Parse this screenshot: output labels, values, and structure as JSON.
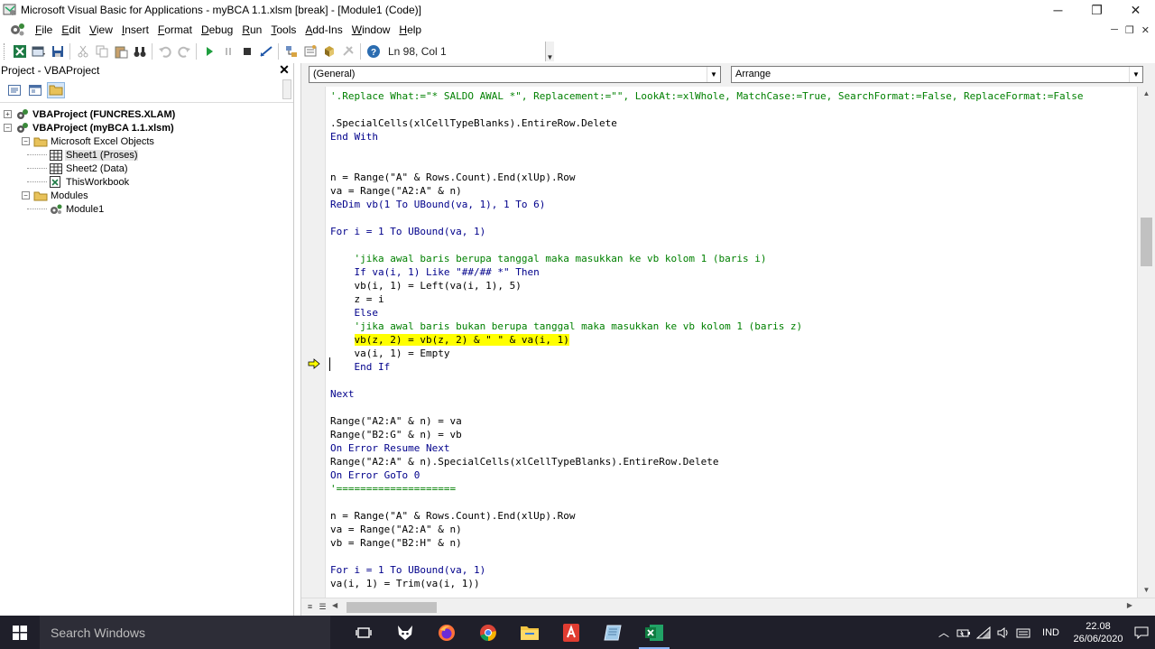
{
  "window": {
    "title": "Microsoft Visual Basic for Applications - myBCA 1.1.xlsm [break] - [Module1 (Code)]",
    "minimize": "─",
    "restore": "❐",
    "close": "✕"
  },
  "menu": {
    "items": [
      {
        "u": "F",
        "rest": "ile"
      },
      {
        "u": "E",
        "rest": "dit"
      },
      {
        "u": "V",
        "rest": "iew"
      },
      {
        "u": "I",
        "rest": "nsert"
      },
      {
        "u": "F",
        "rest": "ormat",
        "pre": ""
      },
      {
        "u": "D",
        "rest": "ebug"
      },
      {
        "u": "R",
        "rest": "un"
      },
      {
        "u": "T",
        "rest": "ools"
      },
      {
        "u": "A",
        "rest": "dd-Ins"
      },
      {
        "u": "W",
        "rest": "indow"
      },
      {
        "u": "H",
        "rest": "elp"
      }
    ],
    "mdi_minimize": "─",
    "mdi_restore": "❐",
    "mdi_close": "✕"
  },
  "toolbar": {
    "cursor_position": "Ln 98, Col 1"
  },
  "project_pane": {
    "title": "Project - VBAProject",
    "close": "✕",
    "tree": [
      {
        "label": "VBAProject (FUNCRES.XLAM)",
        "bold": true,
        "expander": "+",
        "level": 0,
        "icon": "vbaproject-icon"
      },
      {
        "label": "VBAProject (myBCA 1.1.xlsm)",
        "bold": true,
        "expander": "−",
        "level": 0,
        "icon": "vbaproject-icon"
      },
      {
        "label": "Microsoft Excel Objects",
        "bold": false,
        "expander": "−",
        "level": 1,
        "icon": "folder-icon"
      },
      {
        "label": "Sheet1 (Proses)",
        "bold": false,
        "expander": "",
        "level": 2,
        "icon": "worksheet-icon",
        "selected": true
      },
      {
        "label": "Sheet2 (Data)",
        "bold": false,
        "expander": "",
        "level": 2,
        "icon": "worksheet-icon"
      },
      {
        "label": "ThisWorkbook",
        "bold": false,
        "expander": "",
        "level": 2,
        "icon": "workbook-icon"
      },
      {
        "label": "Modules",
        "bold": false,
        "expander": "−",
        "level": 1,
        "icon": "folder-icon"
      },
      {
        "label": "Module1",
        "bold": false,
        "expander": "",
        "level": 2,
        "icon": "module-icon"
      }
    ]
  },
  "code_window": {
    "object_combo": "(General)",
    "procedure_combo": "Arrange",
    "lines": [
      {
        "text": "'.Replace What:=\"* SALDO AWAL *\", Replacement:=\"\", LookAt:=xlWhole, MatchCase:=True, SearchFormat:=False, ReplaceFormat:=False",
        "style": "cm"
      },
      {
        "text": "",
        "style": ""
      },
      {
        "text": ".SpecialCells(xlCellTypeBlanks).EntireRow.Delete",
        "style": ""
      },
      {
        "text": "End With",
        "style": "kw"
      },
      {
        "text": "",
        "style": ""
      },
      {
        "text": "",
        "style": ""
      },
      {
        "text": "n = Range(\"A\" & Rows.Count).End(xlUp).Row",
        "style": ""
      },
      {
        "text": "va = Range(\"A2:A\" & n)",
        "style": ""
      },
      {
        "text": "ReDim vb(1 To UBound(va, 1), 1 To 6)",
        "style": "kw"
      },
      {
        "text": "",
        "style": ""
      },
      {
        "text": "For i = 1 To UBound(va, 1)",
        "style": "kw"
      },
      {
        "text": "",
        "style": ""
      },
      {
        "text": "    'jika awal baris berupa tanggal maka masukkan ke vb kolom 1 (baris i)",
        "style": "cm"
      },
      {
        "text": "    If va(i, 1) Like \"##/## *\" Then",
        "style": "kw"
      },
      {
        "text": "    vb(i, 1) = Left(va(i, 1), 5)",
        "style": ""
      },
      {
        "text": "    z = i",
        "style": ""
      },
      {
        "text": "    Else",
        "style": "kw"
      },
      {
        "text": "    'jika awal baris bukan berupa tanggal maka masukkan ke vb kolom 1 (baris z)",
        "style": "cm"
      },
      {
        "text": "vb(z, 2) = vb(z, 2) & \" \" & va(i, 1)",
        "style": "",
        "indent": "    ",
        "highlight": true
      },
      {
        "text": "    va(i, 1) = Empty",
        "style": ""
      },
      {
        "text": "    End If",
        "style": "kw"
      },
      {
        "text": "",
        "style": ""
      },
      {
        "text": "Next",
        "style": "kw"
      },
      {
        "text": "",
        "style": ""
      },
      {
        "text": "Range(\"A2:A\" & n) = va",
        "style": ""
      },
      {
        "text": "Range(\"B2:G\" & n) = vb",
        "style": ""
      },
      {
        "text": "On Error Resume Next",
        "style": "kw"
      },
      {
        "text": "Range(\"A2:A\" & n).SpecialCells(xlCellTypeBlanks).EntireRow.Delete",
        "style": ""
      },
      {
        "text": "On Error GoTo 0",
        "style": "kw"
      },
      {
        "text": "'====================",
        "style": "cm"
      },
      {
        "text": "",
        "style": ""
      },
      {
        "text": "n = Range(\"A\" & Rows.Count).End(xlUp).Row",
        "style": ""
      },
      {
        "text": "va = Range(\"A2:A\" & n)",
        "style": ""
      },
      {
        "text": "vb = Range(\"B2:H\" & n)",
        "style": ""
      },
      {
        "text": "",
        "style": ""
      },
      {
        "text": "For i = 1 To UBound(va, 1)",
        "style": "kw"
      },
      {
        "text": "va(i, 1) = Trim(va(i, 1))",
        "style": ""
      }
    ]
  },
  "taskbar": {
    "search_placeholder": "Search Windows",
    "language": "IND",
    "time": "22.08",
    "date": "26/06/2020"
  },
  "colors": {
    "keyword": "#00008b",
    "comment": "#008000",
    "execution_highlight": "#ffff00",
    "taskbar": "#1f1f2a"
  }
}
